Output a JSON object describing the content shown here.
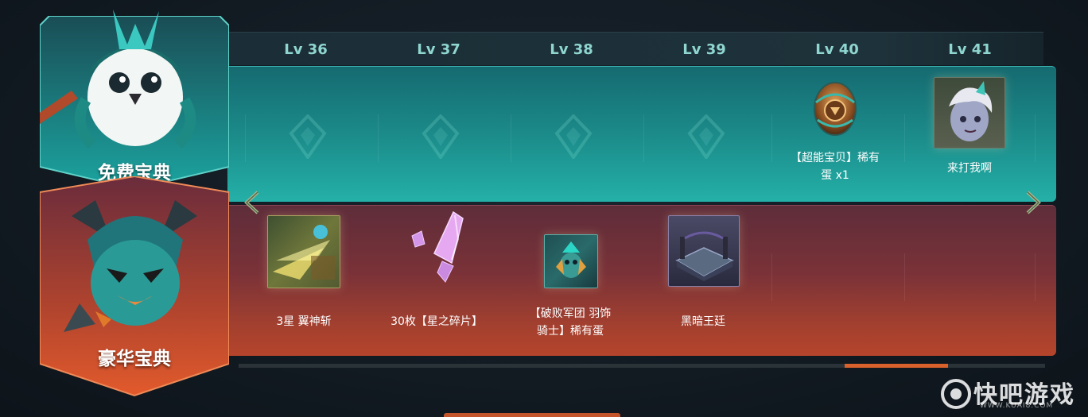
{
  "levels": [
    "Lv 36",
    "Lv 37",
    "Lv 38",
    "Lv 39",
    "Lv 40",
    "Lv 41"
  ],
  "free_track": {
    "title": "免费宝典",
    "rewards": [
      {
        "level": "Lv 40",
        "caption_line1": "【超能宝贝】稀有",
        "caption_line2": "蛋 x1",
        "icon": "egg-icon"
      },
      {
        "level": "Lv 41",
        "caption_line1": "来打我啊",
        "caption_line2": "",
        "icon": "emote-portrait-icon"
      }
    ]
  },
  "premium_track": {
    "title": "豪华宝典",
    "rewards": [
      {
        "level": "Lv 36",
        "caption_line1": "3星 翼神斩",
        "caption_line2": "",
        "icon": "wing-slash-boom-icon"
      },
      {
        "level": "Lv 37",
        "caption_line1": "30枚【星之碎片】",
        "caption_line2": "",
        "icon": "star-shard-crystal-icon"
      },
      {
        "level": "Lv 38",
        "caption_line1": "【破败军团 羽饰",
        "caption_line2": "骑士】稀有蛋",
        "icon": "featherknight-egg-icon"
      },
      {
        "level": "Lv 39",
        "caption_line1": "黑暗王廷",
        "caption_line2": "",
        "icon": "arena-skin-icon"
      }
    ]
  },
  "watermark": {
    "name": "快吧游戏",
    "url": "WWW.KUAI8.COM"
  },
  "colors": {
    "free_accent": "#1c8e8c",
    "premium_accent": "#a3402f",
    "level_text": "#8fd6d0",
    "scroll_thumb": "#d9622c"
  }
}
